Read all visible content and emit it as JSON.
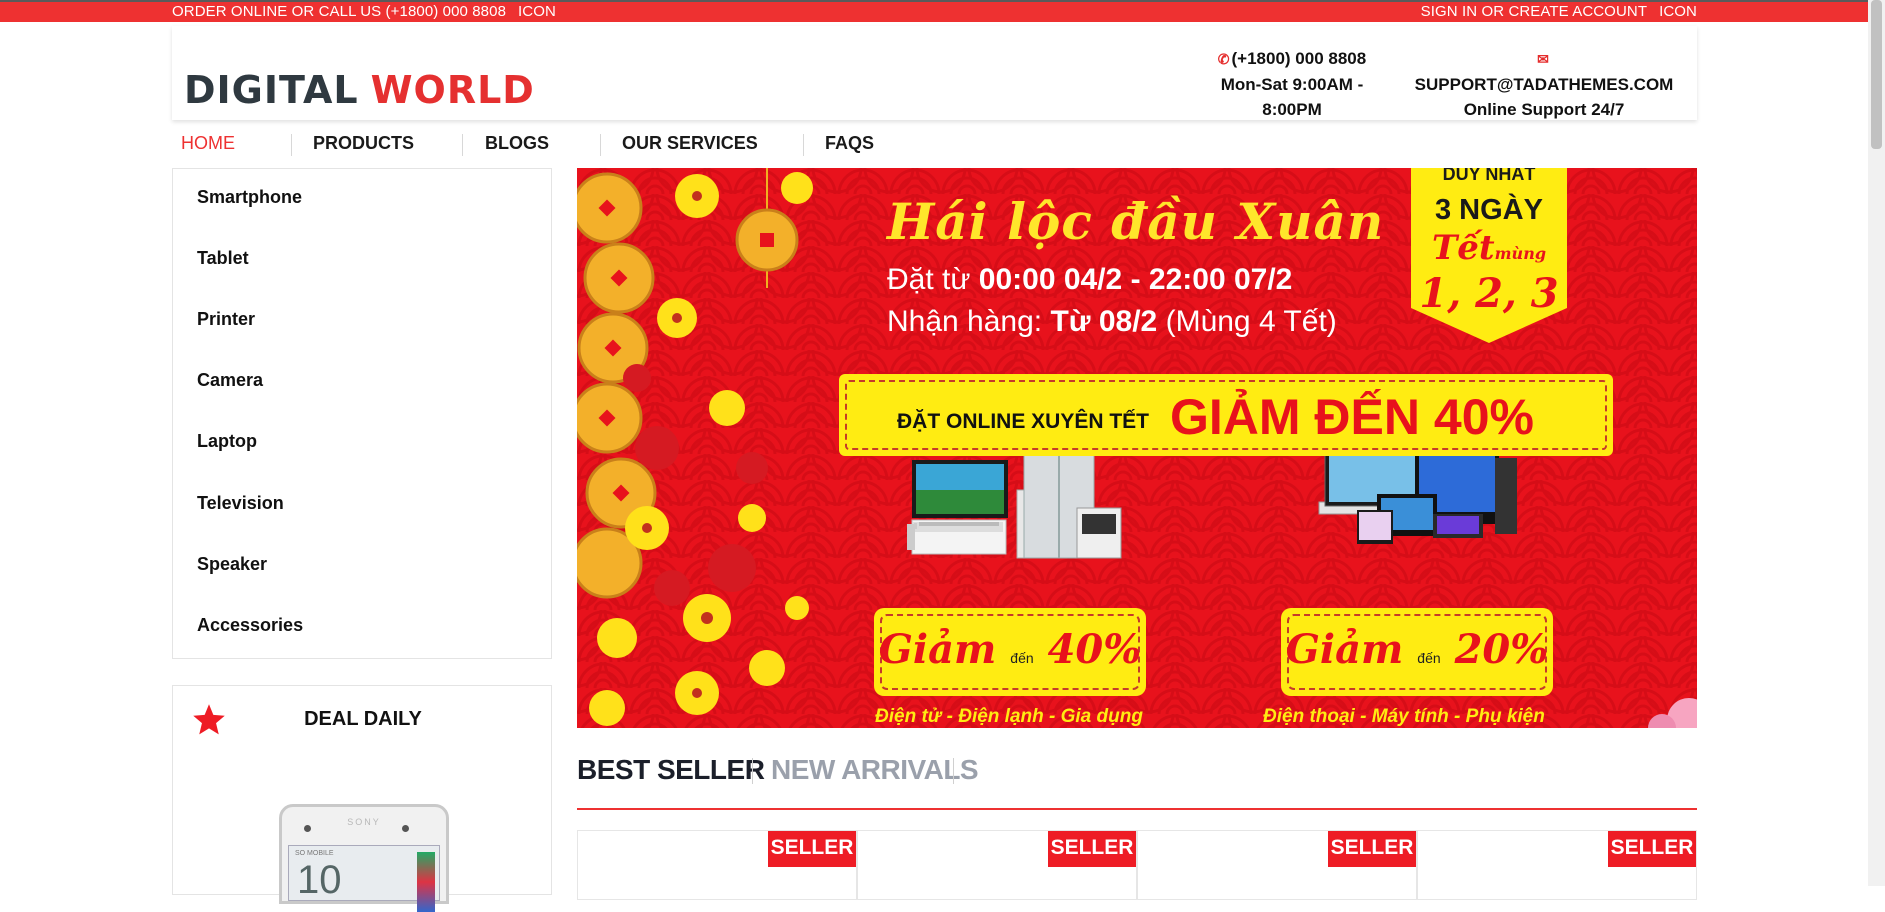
{
  "topbar": {
    "left_text": "Order online or call us (+1800) 000 8808",
    "left_icon": "icon",
    "right_text": "Sign In or Create Account",
    "right_icon": "icon"
  },
  "header": {
    "logo_part1": "DIGITAL",
    "logo_part2": "WORLD",
    "phone": "(+1800) 000 8808",
    "hours": "Mon-Sat 9:00AM - 8:00PM",
    "email": "SUPPORT@TADATHEMES.COM",
    "support": "Online Support 24/7",
    "phone_icon": "phone-icon",
    "mail_icon": "mail-icon"
  },
  "nav": {
    "items": [
      {
        "label": "Home",
        "active": true
      },
      {
        "label": "Products"
      },
      {
        "label": "Blogs"
      },
      {
        "label": "Our Services"
      },
      {
        "label": "FAQs"
      }
    ]
  },
  "categories": [
    "Smartphone",
    "Tablet",
    "Printer",
    "Camera",
    "Laptop",
    "Television",
    "Speaker",
    "Accessories"
  ],
  "deal": {
    "title": "DEAL DAILY",
    "icon": "star-icon",
    "phone_brand": "SONY",
    "phone_status": "SO MOBILE",
    "phone_screen_text": "10"
  },
  "banner": {
    "title": "Hái lộc đầu Xuân",
    "order_prefix": "Đặt từ ",
    "order_period": "00:00 04/2 - 22:00 07/2",
    "receive_prefix": "Nhận hàng: ",
    "receive_date": "Từ 08/2",
    "receive_suffix": " (Mùng 4 Tết)",
    "promo_small": "ĐẶT ONLINE XUYÊN TẾT",
    "promo_big": "GIẢM ĐẾN 40%",
    "tag_line1": "DUY NHẤT",
    "tag_line2": "3 NGÀY",
    "tag_line3": "Tết",
    "tag_line3_small": "mùng",
    "tag_line4": "1, 2, 3",
    "deal1_prefix": "Giảm",
    "deal1_mid": "đến",
    "deal1_value": "40%",
    "deal1_caption": "Điện tử - Điện lạnh - Gia dụng",
    "deal2_prefix": "Giảm",
    "deal2_mid": "đến",
    "deal2_value": "20%",
    "deal2_caption": "Điện thoại - Máy tính - Phụ kiện"
  },
  "tabs": {
    "items": [
      {
        "label": "BEST SELLER",
        "active": true
      },
      {
        "label": "NEW ARRIVALS",
        "active": false
      }
    ]
  },
  "products": [
    {
      "badge": "SELLER"
    },
    {
      "badge": "SELLER"
    },
    {
      "badge": "SELLER"
    },
    {
      "badge": "SELLER"
    }
  ],
  "colors": {
    "accent": "#ee3131",
    "banner_red": "#e8121c",
    "banner_yellow": "#ffec12"
  }
}
